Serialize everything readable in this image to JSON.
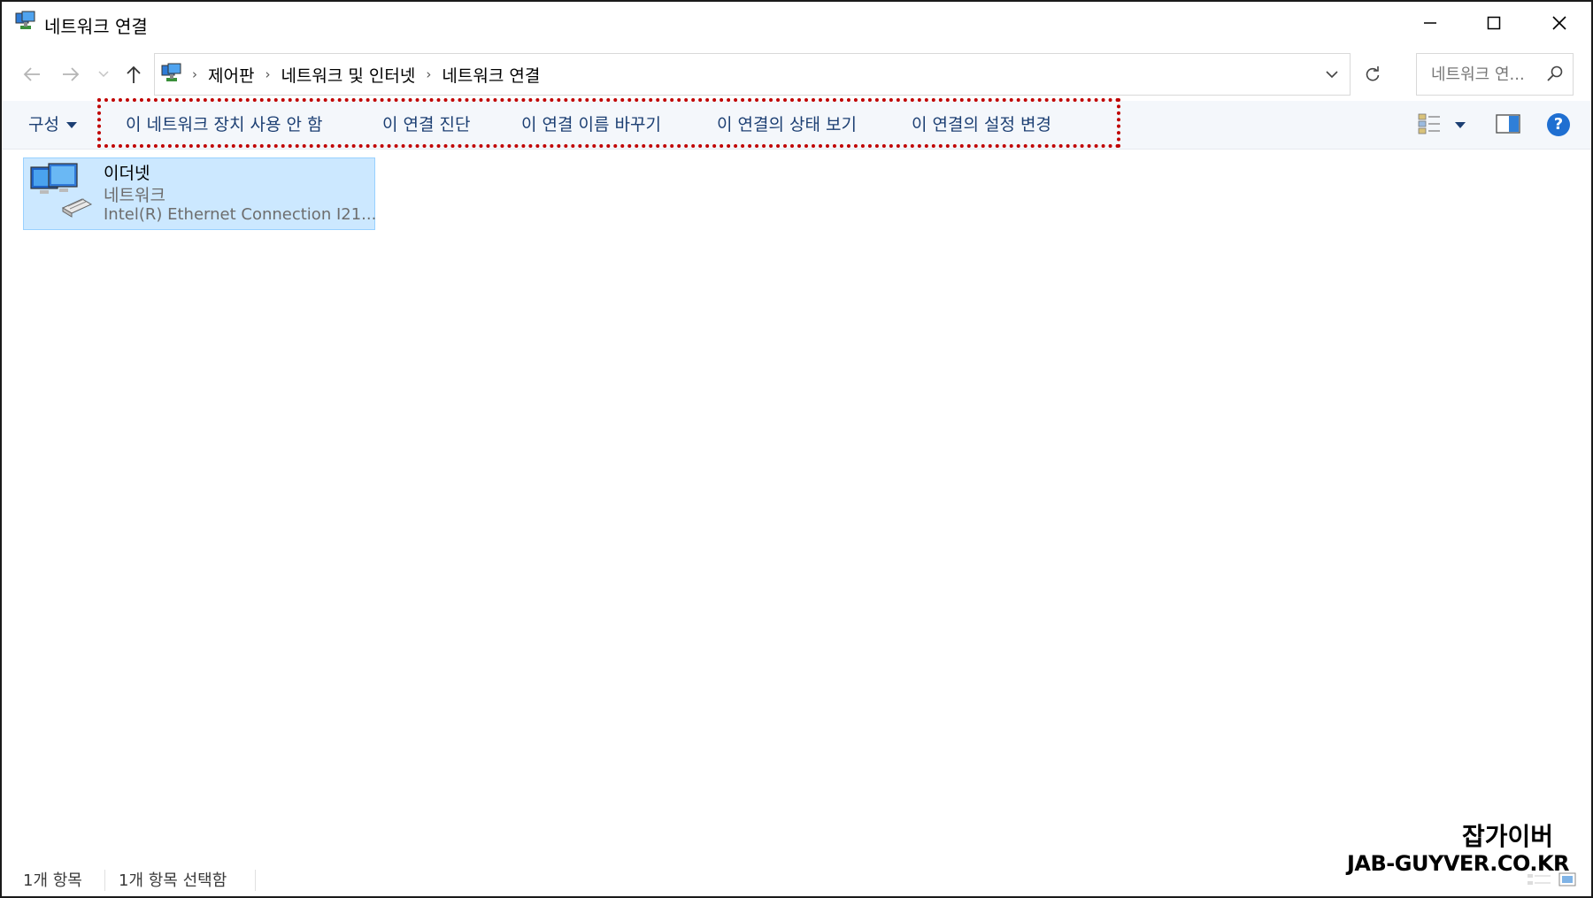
{
  "window": {
    "title": "네트워크 연결",
    "controls": {
      "minimize": "minimize",
      "maximize": "maximize",
      "close": "close"
    }
  },
  "address_bar": {
    "breadcrumbs": [
      "제어판",
      "네트워크 및 인터넷",
      "네트워크 연결"
    ],
    "search_placeholder": "네트워크 연..."
  },
  "command_bar": {
    "organize": "구성",
    "commands": [
      "이 네트워크 장치 사용 안 함",
      "이 연결 진단",
      "이 연결 이름 바꾸기",
      "이 연결의 상태 보기",
      "이 연결의 설정 변경"
    ],
    "highlight_color": "#c00000"
  },
  "items": [
    {
      "name": "이더넷",
      "status": "네트워크",
      "device": "Intel(R) Ethernet Connection I21...",
      "selected": true
    }
  ],
  "status_bar": {
    "item_count": "1개 항목",
    "selected_count": "1개 항목 선택함"
  },
  "watermark": {
    "korean": "잡가이버",
    "english": "JAB-GUYVER.CO.KR"
  },
  "colors": {
    "selection_bg": "#cce8ff",
    "selection_border": "#99d1ff",
    "command_text": "#1c3f73",
    "help_blue": "#1f6fd1"
  }
}
